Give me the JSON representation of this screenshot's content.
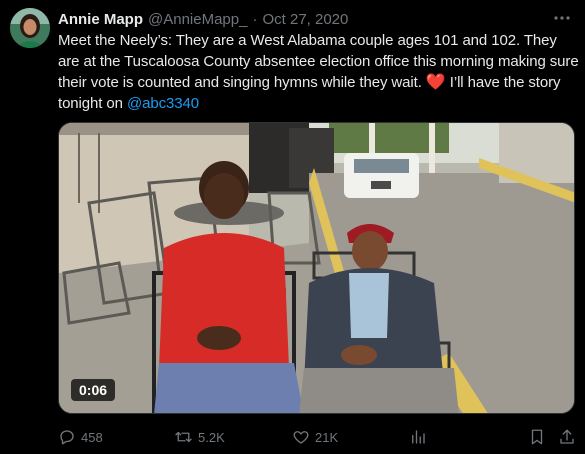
{
  "tweet": {
    "author_name": "Annie Mapp",
    "handle": "@AnnieMapp_",
    "separator": "·",
    "timestamp": "Oct 27, 2020",
    "text_main": "Meet the Neely’s: They are a West Alabama couple ages 101 and 102. They are at the Tuscaloosa County absentee election office this morning making sure their vote is counted and singing hymns while they wait.",
    "heart_emoji": "❤️",
    "text_after_heart": "I’ll have the story tonight on",
    "mention": "@abc3340",
    "video": {
      "duration": "0:06"
    }
  },
  "actions": {
    "replies": "458",
    "reposts": "5.2K",
    "likes": "21K"
  },
  "icons": {
    "more": "more-icon",
    "reply": "reply-icon",
    "repost": "repost-icon",
    "like": "heart-icon",
    "views": "views-icon",
    "bookmark": "bookmark-icon",
    "share": "share-icon"
  },
  "colors": {
    "background": "#000000",
    "text": "#e7e9ea",
    "secondary": "#71767b",
    "link": "#1d9bf0",
    "heart": "#f4212e"
  }
}
